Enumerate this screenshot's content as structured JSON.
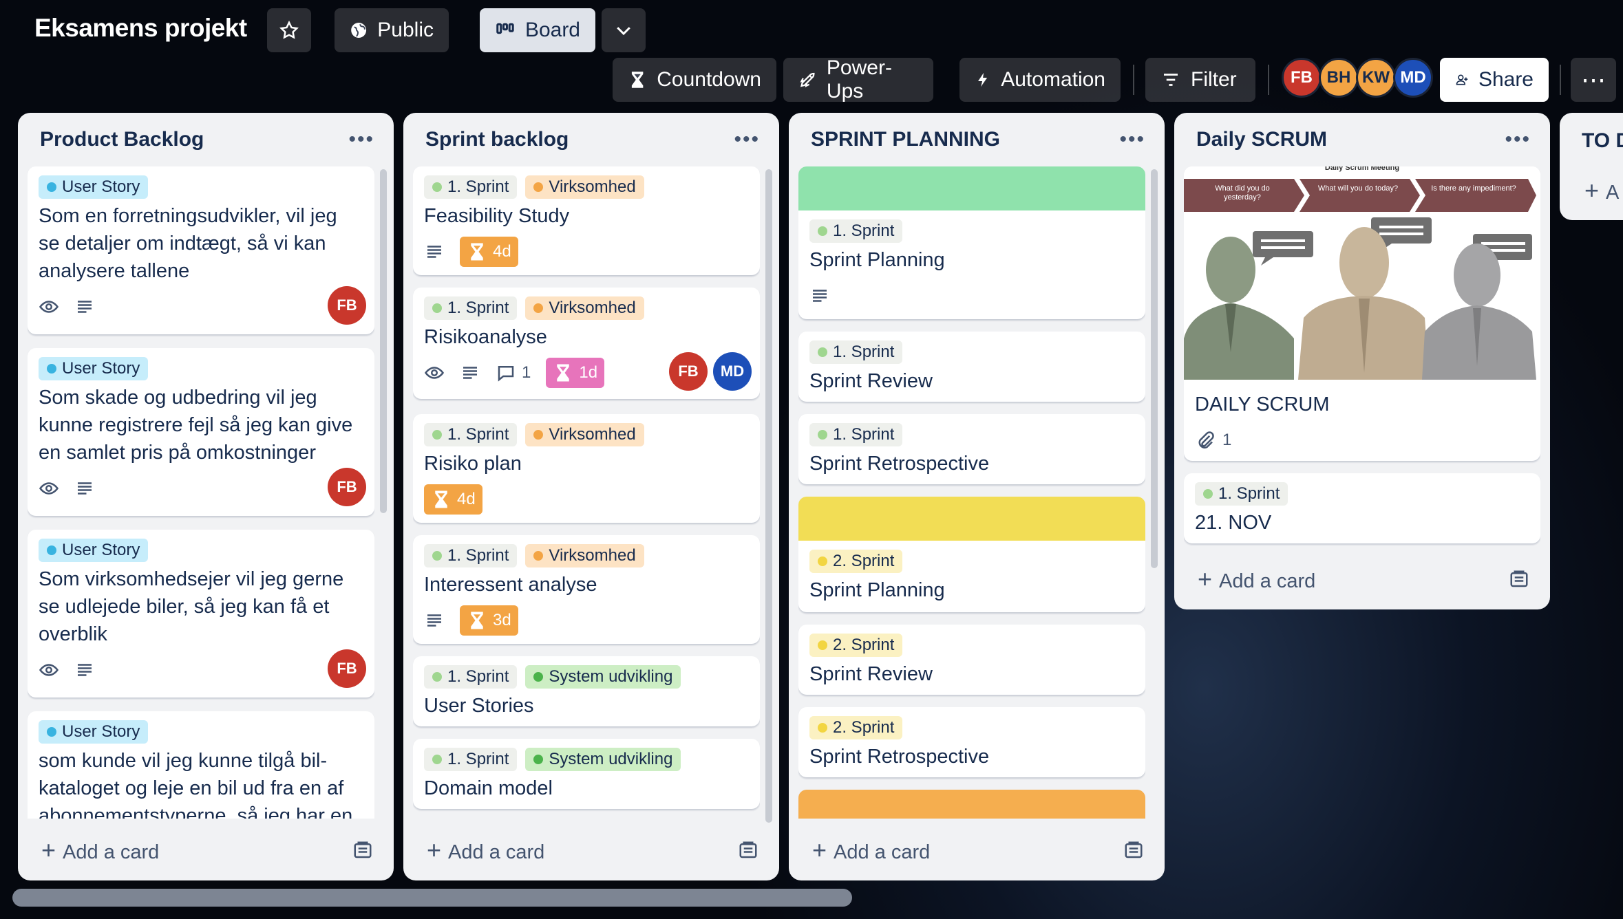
{
  "board": {
    "title": "Eksamens projekt",
    "visibility_label": "Public",
    "view_label": "Board",
    "colors": {
      "accent_red": "#c9372c",
      "accent_blue": "#1d4fb8",
      "orange": "#f3a444",
      "pink": "#e774bb"
    }
  },
  "header": {
    "countdown_label": "Countdown",
    "powerups_label": "Power-Ups",
    "automation_label": "Automation",
    "filter_label": "Filter",
    "share_label": "Share",
    "members": [
      "FB",
      "BH",
      "KW",
      "MD"
    ]
  },
  "lists": [
    {
      "title": "Product Backlog",
      "add_label": "Add a card",
      "cards": [
        {
          "label": "User Story",
          "title": "Som en forretningsudvikler, vil jeg se detaljer om indtægt, så vi kan analysere tallene",
          "member": "FB"
        },
        {
          "label": "User Story",
          "title": "Som skade og udbedring vil jeg kunne registrere fejl så jeg kan give en samlet pris på omkostninger",
          "member": "FB"
        },
        {
          "label": "User Story",
          "title": "Som virksomhedsejer vil jeg gerne se udlejede biler, så jeg kan få et overblik",
          "member": "FB"
        },
        {
          "label": "User Story",
          "title": "som kunde vil jeg kunne tilgå bil-kataloget og leje en bil ud fra en af abonnementstyperne, så jeg har en"
        }
      ]
    },
    {
      "title": "Sprint backlog",
      "add_label": "Add a card",
      "cards": [
        {
          "label1": "1. Sprint",
          "label2": "Virksomhed",
          "title": "Feasibility Study",
          "countdown": "4d"
        },
        {
          "label1": "1. Sprint",
          "label2": "Virksomhed",
          "title": "Risikoanalyse",
          "comments": "1",
          "countdown": "1d",
          "members": [
            "FB",
            "MD"
          ]
        },
        {
          "label1": "1. Sprint",
          "label2": "Virksomhed",
          "title": "Risiko plan",
          "countdown": "4d"
        },
        {
          "label1": "1. Sprint",
          "label2": "Virksomhed",
          "title": "Interessent analyse",
          "countdown": "3d"
        },
        {
          "label1": "1. Sprint",
          "label2": "System udvikling",
          "title": "User Stories"
        },
        {
          "label1": "1. Sprint",
          "label2": "System udvikling",
          "title": "Domain model"
        }
      ]
    },
    {
      "title": "SPRINT PLANNING",
      "add_label": "Add a card",
      "cards": [
        {
          "label": "1. Sprint",
          "title": "Sprint Planning"
        },
        {
          "label": "1. Sprint",
          "title": "Sprint Review"
        },
        {
          "label": "1. Sprint",
          "title": "Sprint Retrospective"
        },
        {
          "label": "2. Sprint",
          "title": "Sprint Planning"
        },
        {
          "label": "2. Sprint",
          "title": "Sprint Review"
        },
        {
          "label": "2. Sprint",
          "title": "Sprint Retrospective"
        }
      ]
    },
    {
      "title": "Daily SCRUM",
      "add_label": "Add a card",
      "cards": [
        {
          "image_title": "Daily Scrum Meeting",
          "image_q1": "What did you do yesterday?",
          "image_q2": "What will you do today?",
          "image_q3": "Is there any impediment?",
          "title": "DAILY SCRUM",
          "attachments": "1"
        },
        {
          "label": "1. Sprint",
          "title": "21. NOV"
        }
      ]
    },
    {
      "title": "TO D",
      "add_label": "A"
    }
  ]
}
